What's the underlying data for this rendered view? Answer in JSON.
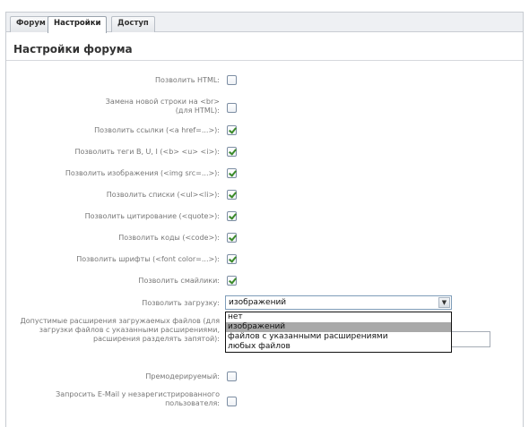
{
  "tabs": [
    {
      "label": "Форум"
    },
    {
      "label": "Настройки"
    },
    {
      "label": "Доступ"
    }
  ],
  "section": {
    "title": "Настройки форума"
  },
  "settings": [
    {
      "label": "Позволить HTML:",
      "checked": false
    },
    {
      "label": "Замена новой строки на <br> (для HTML):",
      "checked": false
    },
    {
      "label": "Позволить ссылки (<a href=...>):",
      "checked": true
    },
    {
      "label": "Позволить теги B, U, I (<b> <u> <i>):",
      "checked": true
    },
    {
      "label": "Позволить изображения (<img src=...>):",
      "checked": true
    },
    {
      "label": "Позволить списки (<ul><li>):",
      "checked": true
    },
    {
      "label": "Позволить цитирование (<quote>):",
      "checked": true
    },
    {
      "label": "Позволить коды (<code>):",
      "checked": true
    },
    {
      "label": "Позволить шрифты (<font color=...>):",
      "checked": true
    },
    {
      "label": "Позволить смайлики:",
      "checked": true
    }
  ],
  "upload": {
    "label": "Позволить загрузку:",
    "selected": "изображений",
    "options": [
      "нет",
      "изображений",
      "файлов с указанными расширениями",
      "любых файлов"
    ],
    "highlighted_index": 1
  },
  "extensions": {
    "label": "Допустимые расширения загружаемых файлов (для загрузки файлов с указанными расширениями, расширения разделять запятой):",
    "value": ""
  },
  "premoderation": {
    "label": "Премодерируемый:",
    "checked": false
  },
  "email_request": {
    "label": "Запросить E-Mail у незарегистрированного пользователя:",
    "checked": false
  }
}
